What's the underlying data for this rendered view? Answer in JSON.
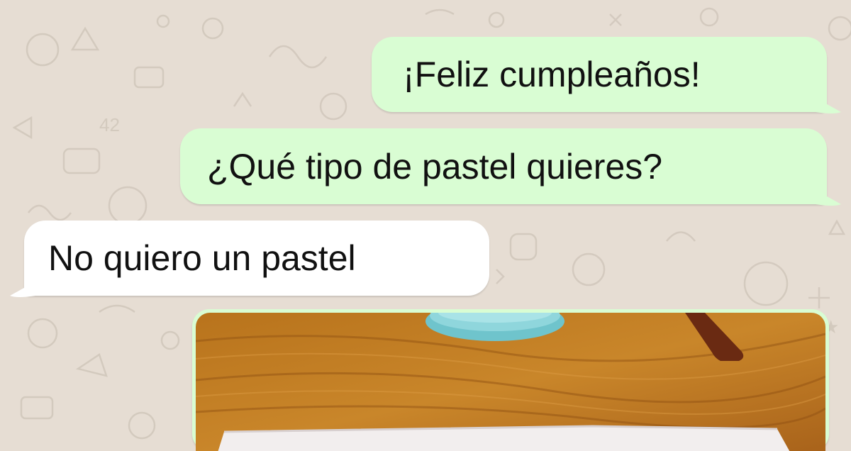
{
  "chat": {
    "messages": [
      {
        "direction": "outgoing",
        "text": "¡Feliz cumpleaños!"
      },
      {
        "direction": "outgoing",
        "text": "¿Qué tipo de pastel quieres?"
      },
      {
        "direction": "incoming",
        "text": "No quiero un pastel"
      },
      {
        "direction": "outgoing",
        "type": "image"
      }
    ]
  },
  "colors": {
    "wallpaper": "#e6ddd3",
    "outgoing_bubble": "#d9fdd3",
    "incoming_bubble": "#ffffff"
  },
  "icons": [
    "plate-icon",
    "doodle-pattern"
  ]
}
